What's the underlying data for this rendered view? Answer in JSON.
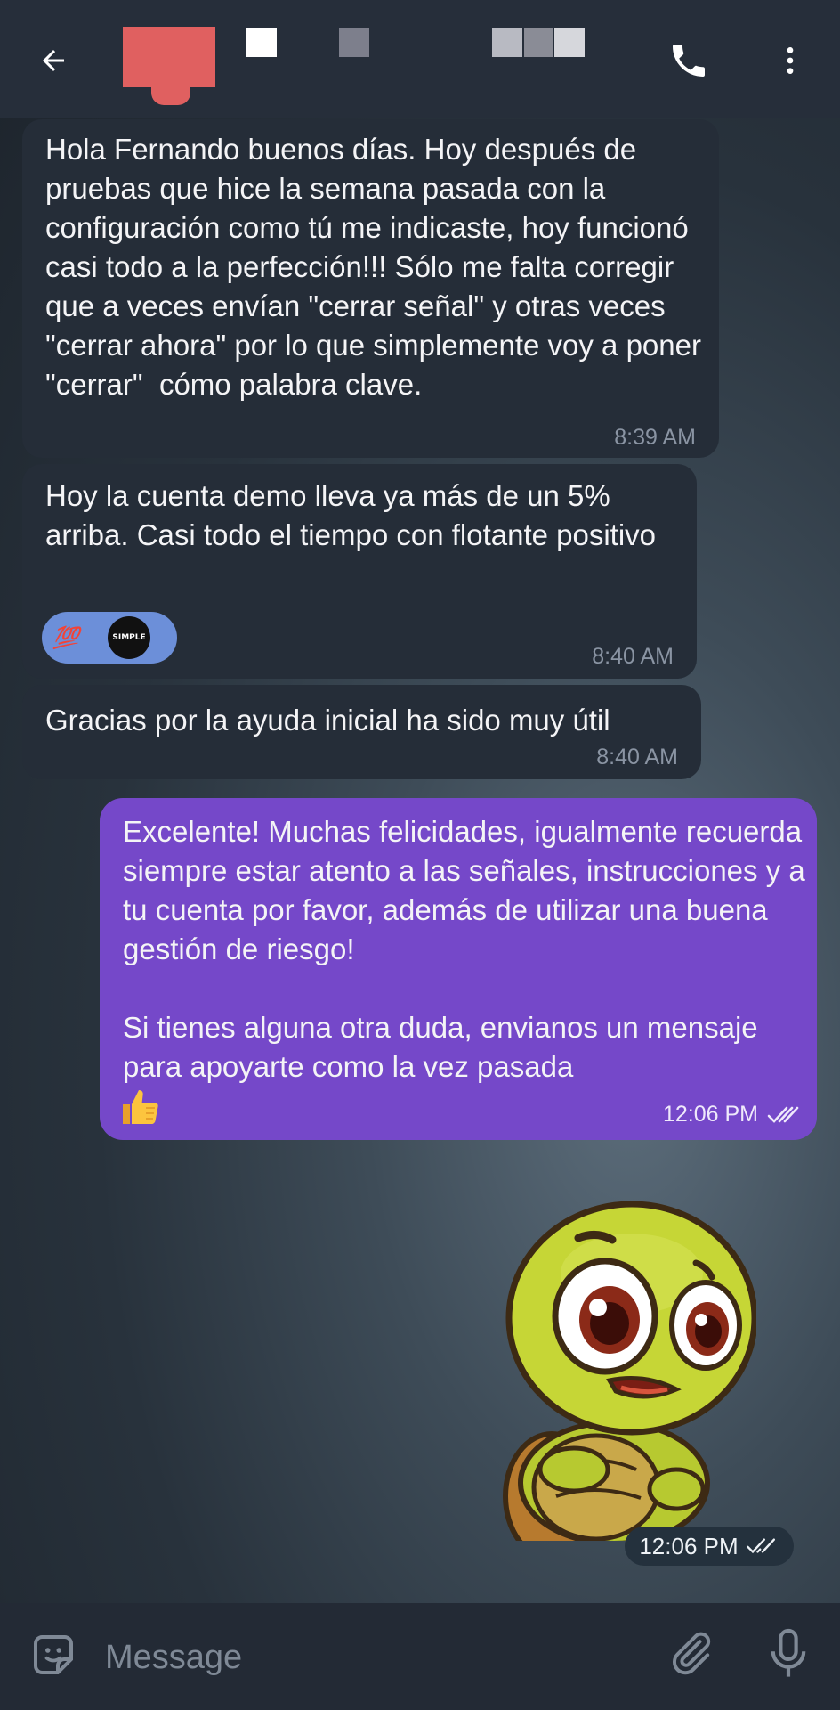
{
  "colors": {
    "header_bg": "#262e3a",
    "incoming_bubble": "#252d38",
    "outgoing_bubble": "#7548c9",
    "reaction_bg": "#6c8fd9",
    "time_incoming": "#8a94a3"
  },
  "header": {
    "back_icon": "arrow-left-icon",
    "call_icon": "phone-icon",
    "menu_icon": "more-vertical-icon"
  },
  "messages": [
    {
      "direction": "incoming",
      "text": "Hola Fernando buenos días. Hoy después de pruebas que hice la semana pasada con la configuración como tú me indicaste, hoy funcionó casi todo a la perfección!!! Sólo me falta corregir que a veces envían \"cerrar señal\" y otras veces \"cerrar ahora\" por lo que simplemente voy a poner \"cerrar\"  cómo palabra clave.",
      "time": "8:39 AM"
    },
    {
      "direction": "incoming",
      "text": "Hoy la cuenta demo lleva ya más de un 5% arriba. Casi todo el tiempo con flotante positivo",
      "time": "8:40 AM",
      "reaction": {
        "emoji": "💯",
        "avatar_text": "SIMPLE"
      }
    },
    {
      "direction": "incoming",
      "text": "Gracias por la ayuda inicial ha sido muy útil",
      "time": "8:40 AM"
    },
    {
      "direction": "outgoing",
      "text": "Excelente! Muchas felicidades, igualmente recuerda siempre estar atento a las señales, instrucciones y a tu cuenta por favor, además de utilizar una buena gestión de riesgo!\n\nSi tienes alguna otra duda, envianos un mensaje para apoyarte como la vez pasada",
      "emoji": "👍",
      "time": "12:06 PM",
      "status_icon": "double-check-icon"
    },
    {
      "direction": "outgoing",
      "type": "sticker",
      "sticker": "turtle-sticker",
      "time": "12:06 PM",
      "status_icon": "double-check-icon"
    }
  ],
  "composer": {
    "placeholder": "Message",
    "emoji_icon": "sticker-smile-icon",
    "attach_icon": "paperclip-icon",
    "mic_icon": "microphone-icon"
  }
}
